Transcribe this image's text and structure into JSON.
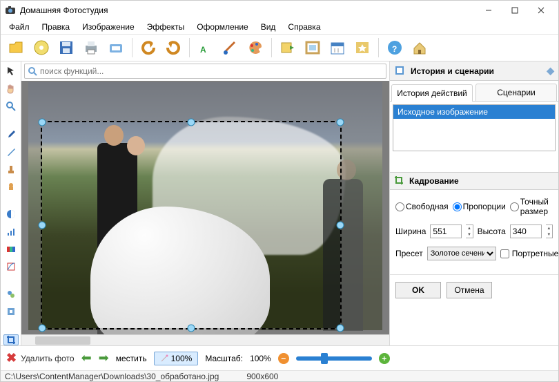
{
  "app": {
    "title": "Домашняя Фотостудия"
  },
  "menu": [
    "Файл",
    "Правка",
    "Изображение",
    "Эффекты",
    "Оформление",
    "Вид",
    "Справка"
  ],
  "toolbar_icons": [
    "open-folder",
    "disc",
    "save",
    "print",
    "scan",
    "sep",
    "undo",
    "redo",
    "sep",
    "text",
    "brush",
    "palette",
    "sep",
    "export",
    "frame",
    "calendar",
    "star-image",
    "sep",
    "help",
    "home"
  ],
  "search": {
    "placeholder": "поиск функций..."
  },
  "side_tools": [
    "pointer",
    "hand",
    "zoom",
    "sep",
    "dropper",
    "brush",
    "stamp",
    "pawn",
    "sep",
    "contrast",
    "levels",
    "color",
    "curves",
    "sep",
    "effects",
    "plugin",
    "sep",
    "crop"
  ],
  "right": {
    "history_title": "История и сценарии",
    "tabs": {
      "actions": "История действий",
      "scenarios": "Сценарии"
    },
    "history_items": [
      "Исходное изображение"
    ],
    "crop_title": "Кадрование",
    "radios": {
      "free": "Свободная",
      "ratio": "Пропорции",
      "exact": "Точный размер"
    },
    "width_label": "Ширина",
    "height_label": "Высота",
    "width_value": "551",
    "height_value": "340",
    "preset_label": "Пресет",
    "preset_value": "Золотое сечение",
    "portrait_label": "Портретные",
    "ok": "OK",
    "cancel": "Отмена"
  },
  "bottom": {
    "delete_photo": "Удалить фото",
    "move": "местить",
    "fit": "100%",
    "zoom_label": "Масштаб:",
    "zoom_value": "100%"
  },
  "status": {
    "path": "C:\\Users\\ContentManager\\Downloads\\30_обработано.jpg",
    "dims": "900x600"
  }
}
